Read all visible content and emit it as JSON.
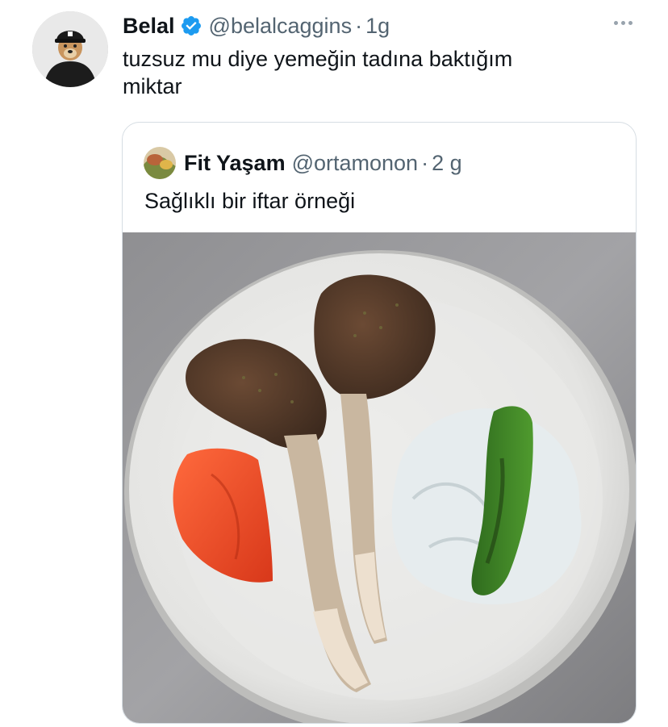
{
  "tweet": {
    "author_name": "Belal",
    "handle": "@belalcaggins",
    "separator": "·",
    "time": "1g",
    "text": "tuzsuz mu diye yemeğin tadına baktığım\nmiktar"
  },
  "quoted_tweet": {
    "author_name": "Fit Yaşam",
    "handle": "@ortamonon",
    "separator": "·",
    "time": "2 g",
    "text": "Sağlıklı bir iftar örneği"
  },
  "icons": {
    "verified": "verified-badge-icon",
    "more": "more-options-icon"
  },
  "colors": {
    "verified_blue": "#1d9bf0",
    "secondary_text": "#536471",
    "primary_text": "#0f1419"
  }
}
